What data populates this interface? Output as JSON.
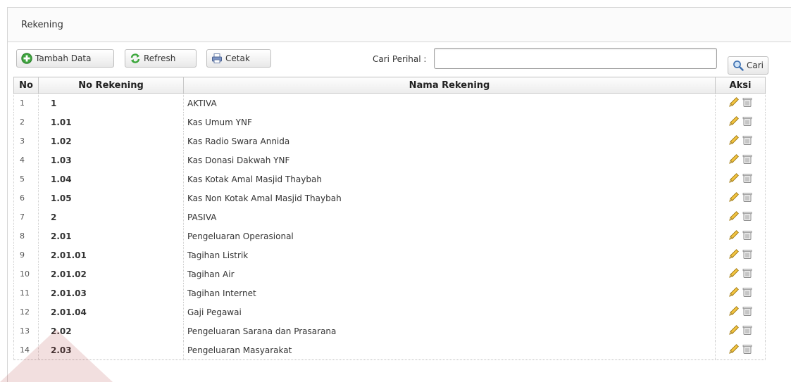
{
  "panel": {
    "title": "Rekening"
  },
  "toolbar": {
    "add_label": "Tambah Data",
    "refresh_label": "Refresh",
    "print_label": "Cetak",
    "search_label": "Cari Perihal :",
    "search_value": "",
    "search_button_label": "Cari"
  },
  "table": {
    "headers": {
      "no": "No",
      "rekening": "No Rekening",
      "nama": "Nama Rekening",
      "aksi": "Aksi"
    },
    "rows": [
      {
        "no": "1",
        "rekening": "1",
        "nama": "AKTIVA"
      },
      {
        "no": "2",
        "rekening": "1.01",
        "nama": "Kas Umum YNF"
      },
      {
        "no": "3",
        "rekening": "1.02",
        "nama": "Kas Radio Swara Annida"
      },
      {
        "no": "4",
        "rekening": "1.03",
        "nama": "Kas Donasi Dakwah YNF"
      },
      {
        "no": "5",
        "rekening": "1.04",
        "nama": "Kas Kotak Amal Masjid Thaybah"
      },
      {
        "no": "6",
        "rekening": "1.05",
        "nama": "Kas Non Kotak Amal Masjid Thaybah"
      },
      {
        "no": "7",
        "rekening": "2",
        "nama": "PASIVA"
      },
      {
        "no": "8",
        "rekening": "2.01",
        "nama": "Pengeluaran Operasional"
      },
      {
        "no": "9",
        "rekening": "2.01.01",
        "nama": "Tagihan Listrik"
      },
      {
        "no": "10",
        "rekening": "2.01.02",
        "nama": "Tagihan Air"
      },
      {
        "no": "11",
        "rekening": "2.01.03",
        "nama": "Tagihan Internet"
      },
      {
        "no": "12",
        "rekening": "2.01.04",
        "nama": "Gaji Pegawai"
      },
      {
        "no": "13",
        "rekening": "2.02",
        "nama": "Pengeluaran Sarana dan Prasarana"
      },
      {
        "no": "14",
        "rekening": "2.03",
        "nama": "Pengeluaran Masyarakat"
      }
    ]
  },
  "icons": {
    "add": "plus-circle-icon",
    "refresh": "refresh-icon",
    "print": "printer-icon",
    "search": "magnifier-icon",
    "edit": "pencil-icon",
    "delete": "trash-icon"
  }
}
